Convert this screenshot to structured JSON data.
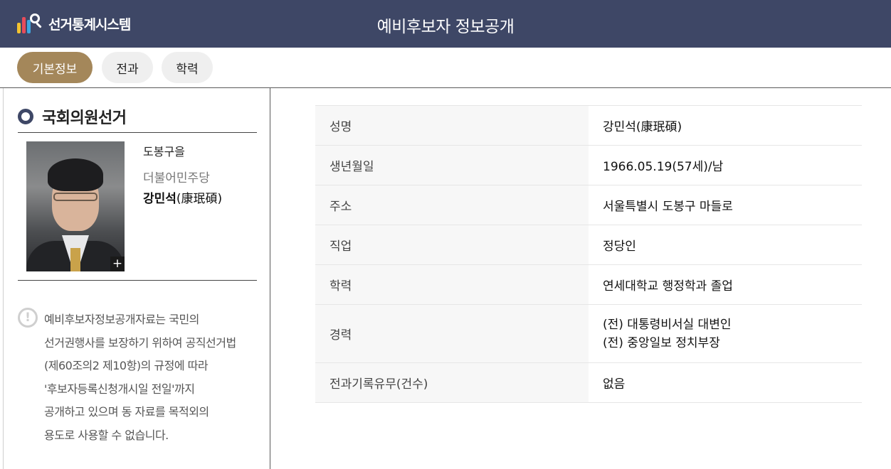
{
  "header": {
    "logo_text": "선거통계시스템",
    "title": "예비후보자 정보공개",
    "bg_color": "#3e4766"
  },
  "tabs": [
    {
      "label": "기본정보",
      "active": true
    },
    {
      "label": "전과",
      "active": false
    },
    {
      "label": "학력",
      "active": false
    }
  ],
  "sidebar": {
    "section_title": "국회의원선거",
    "candidate": {
      "district": "도봉구을",
      "party": "더불어민주당",
      "name": "강민석",
      "name_hanja": "(康珉碩)"
    },
    "photo_zoom_label": "+",
    "notice_icon": "!",
    "notice_lines": [
      "예비후보자정보공개자료는 국민의",
      "선거권행사를 보장하기 위하여 공직선거법",
      "(제60조의2 제10항)의 규정에 따라",
      "'후보자등록신청개시일 전일'까지",
      "공개하고 있으며 동 자료를 목적외의",
      "용도로 사용할 수 없습니다."
    ]
  },
  "info": {
    "rows": [
      {
        "label": "성명",
        "value": "강민석(康珉碩)"
      },
      {
        "label": "생년월일",
        "value": "1966.05.19(57세)/남"
      },
      {
        "label": "주소",
        "value": "서울특별시 도봉구 마들로"
      },
      {
        "label": "직업",
        "value": "정당인"
      },
      {
        "label": "학력",
        "value": "연세대학교 행정학과 졸업"
      },
      {
        "label": "경력",
        "value_lines": [
          "(전) 대통령비서실 대변인",
          "(전) 중앙일보 정치부장"
        ]
      },
      {
        "label": "전과기록유무(건수)",
        "value": "없음"
      }
    ]
  },
  "colors": {
    "accent_tab": "#a4875a",
    "section_ring": "#3e4766"
  }
}
